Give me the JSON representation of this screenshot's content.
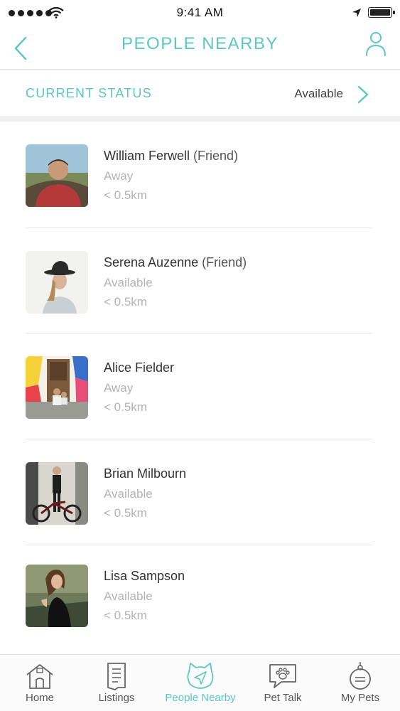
{
  "status_bar": {
    "time": "9:41 AM"
  },
  "header": {
    "title": "PEOPLE NEARBY",
    "back_icon": "back-chevron-icon",
    "profile_icon": "user-profile-icon",
    "accent_color": "#5ec6c2"
  },
  "current_status": {
    "label": "CURRENT STATUS",
    "value": "Available"
  },
  "people": [
    {
      "name": "William Ferwell",
      "tag": "(Friend)",
      "status": "Away",
      "distance": "< 0.5km"
    },
    {
      "name": "Serena Auzenne",
      "tag": "(Friend)",
      "status": "Available",
      "distance": "< 0.5km"
    },
    {
      "name": "Alice Fielder",
      "tag": "",
      "status": "Away",
      "distance": "< 0.5km"
    },
    {
      "name": "Brian Milbourn",
      "tag": "",
      "status": "Available",
      "distance": "< 0.5km"
    },
    {
      "name": "Lisa Sampson",
      "tag": "",
      "status": "Available",
      "distance": "< 0.5km"
    }
  ],
  "tabs": [
    {
      "label": "Home",
      "icon": "home-icon",
      "active": false
    },
    {
      "label": "Listings",
      "icon": "listings-icon",
      "active": false
    },
    {
      "label": "People Nearby",
      "icon": "cat-compass-icon",
      "active": true
    },
    {
      "label": "Pet Talk",
      "icon": "paw-chat-icon",
      "active": false
    },
    {
      "label": "My Pets",
      "icon": "pet-tag-icon",
      "active": false
    }
  ]
}
